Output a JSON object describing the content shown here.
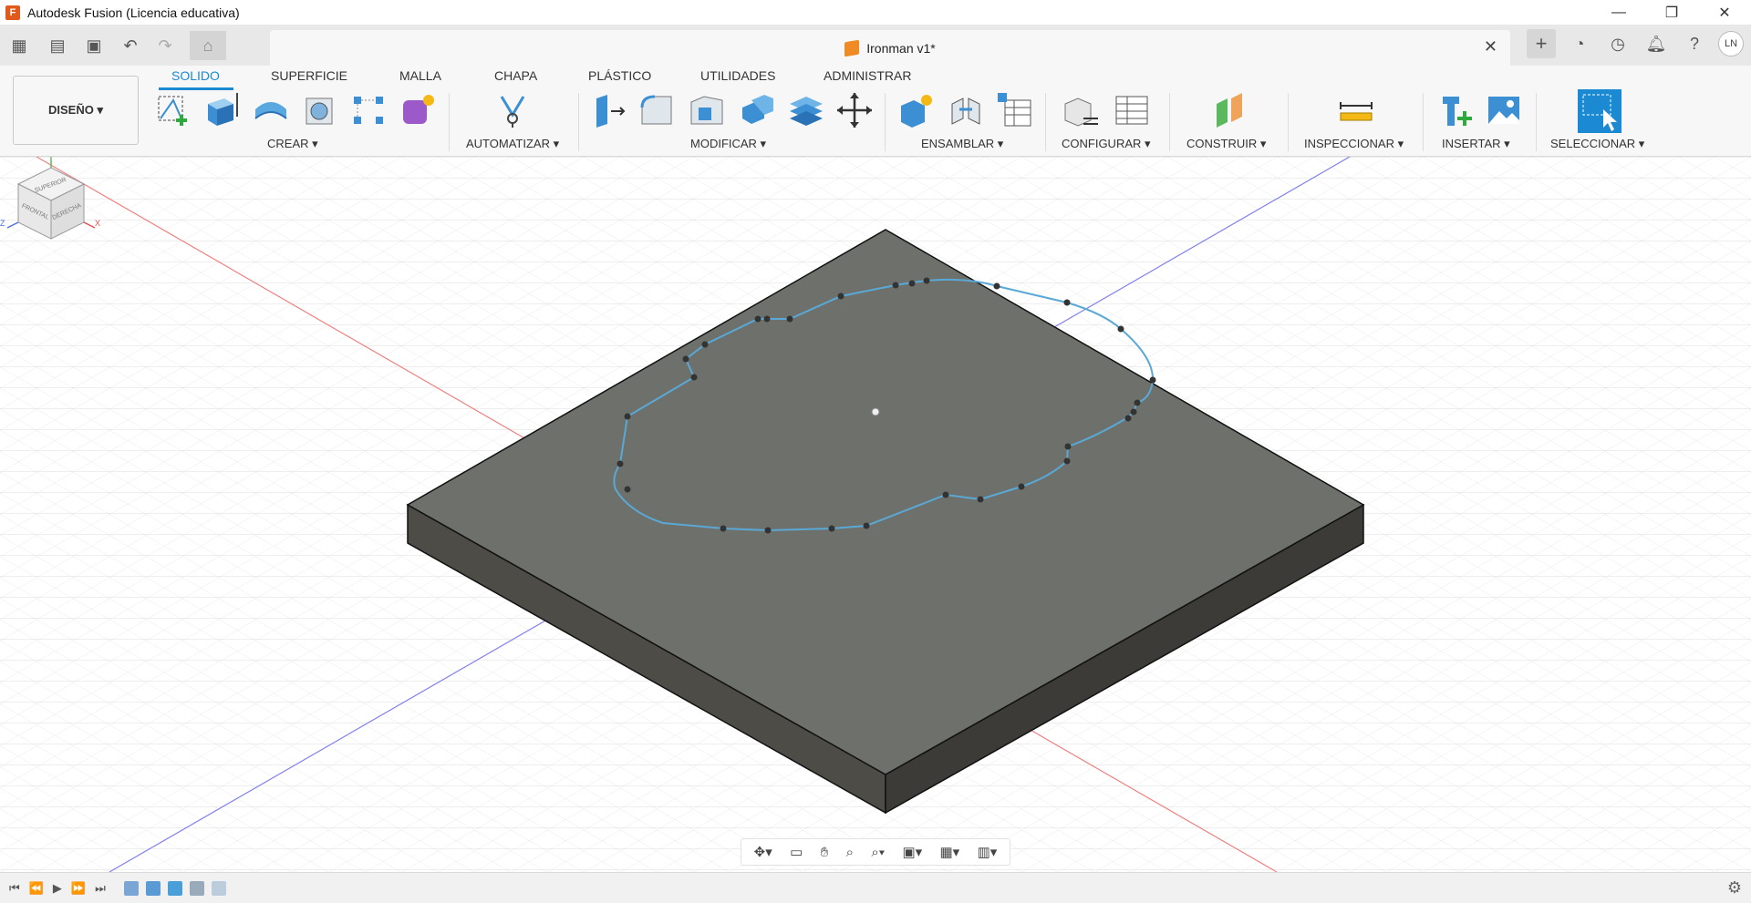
{
  "window": {
    "title": "Autodesk Fusion (Licencia educativa)",
    "logo": "F"
  },
  "document": {
    "tab_label": "Ironman v1*"
  },
  "user": {
    "initials": "LN"
  },
  "workspace": {
    "label": "DISEÑO ▾"
  },
  "ribbon_tabs": [
    "SOLIDO",
    "SUPERFICIE",
    "MALLA",
    "CHAPA",
    "PLÁSTICO",
    "UTILIDADES",
    "ADMINISTRAR"
  ],
  "groups": {
    "crear": "CREAR ▾",
    "automatizar": "AUTOMATIZAR ▾",
    "modificar": "MODIFICAR ▾",
    "ensamblar": "ENSAMBLAR ▾",
    "configurar": "CONFIGURAR ▾",
    "construir": "CONSTRUIR ▾",
    "inspeccionar": "INSPECCIONAR ▾",
    "insertar": "INSERTAR ▾",
    "seleccionar": "SELECCIONAR ▾"
  },
  "view_cube": {
    "top": "SUPERIOR",
    "front": "FRONTAL",
    "right": "DERECHA",
    "axis_x": "X",
    "axis_y": "Y",
    "axis_z": "Z"
  },
  "colors": {
    "accent": "#1b8ad3",
    "plate_top": "#6e716b",
    "sketch": "#5aa8d6"
  }
}
